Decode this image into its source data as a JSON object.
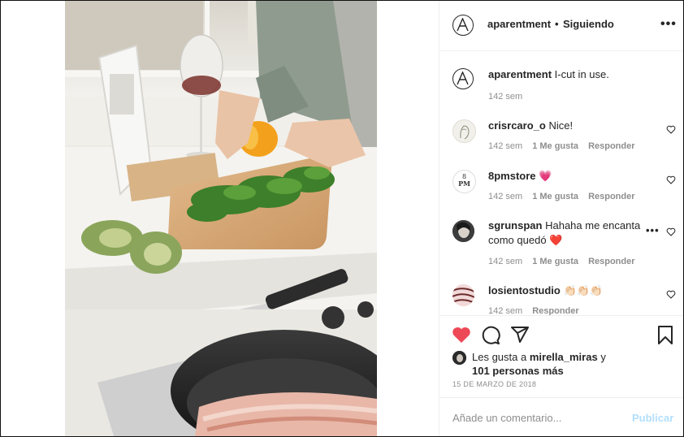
{
  "post": {
    "username": "aparentment",
    "follow_separator": "•",
    "follow_status": "Siguiendo",
    "more": "•••"
  },
  "caption": {
    "username": "aparentment",
    "text": "I-cut in use.",
    "time": "142 sem"
  },
  "comments": [
    {
      "username": "crisrcaro_o",
      "text": "Nice!",
      "time": "142 sem",
      "likes": "1 Me gusta",
      "reply": "Responder"
    },
    {
      "username": "8pmstore",
      "text": "💗",
      "time": "142 sem",
      "likes": "1 Me gusta",
      "reply": "Responder"
    },
    {
      "username": "sgrunspan",
      "text": "Hahaha me encanta como quedó ❤️",
      "time": "142 sem",
      "likes": "1 Me gusta",
      "reply": "Responder"
    },
    {
      "username": "losientostudio",
      "text": "👏🏻👏🏻👏🏻",
      "time": "142 sem",
      "likes": "",
      "reply": "Responder"
    }
  ],
  "avatar_labels": {
    "eightpm_line1": "8",
    "eightpm_line2": "PM"
  },
  "likes": {
    "prefix": "Les gusta a",
    "user": "mirella_miras",
    "middle": "y",
    "others": "101 personas más"
  },
  "date": "15 DE MARZO DE 2018",
  "add_comment": {
    "placeholder": "Añade un comentario...",
    "publish": "Publicar"
  },
  "colors": {
    "heart_liked": "#ed4956",
    "publish_disabled": "#b2dffc",
    "secondary_text": "#8e8e8e"
  },
  "icons": {
    "like": "heart-filled-icon",
    "comment": "comment-bubble-icon",
    "share": "paper-plane-icon",
    "save": "bookmark-icon",
    "comment_like": "heart-outline-icon",
    "options": "more-dots-icon"
  }
}
